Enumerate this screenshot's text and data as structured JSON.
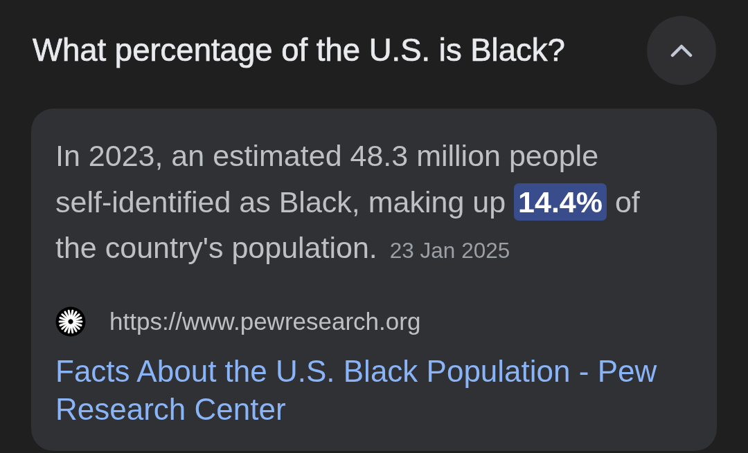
{
  "question": {
    "text": "What percentage of the U.S. is Black?",
    "expanded": true
  },
  "answer": {
    "snippet": "In 2023, an estimated 48.3 million people self-identified as Black, making up **14.4%** of the country's population.",
    "date": "23 Jan 2025"
  },
  "source": {
    "url": "https://www.pewresearch.org",
    "title": "Facts About the U.S. Black Population - Pew Research Center"
  }
}
